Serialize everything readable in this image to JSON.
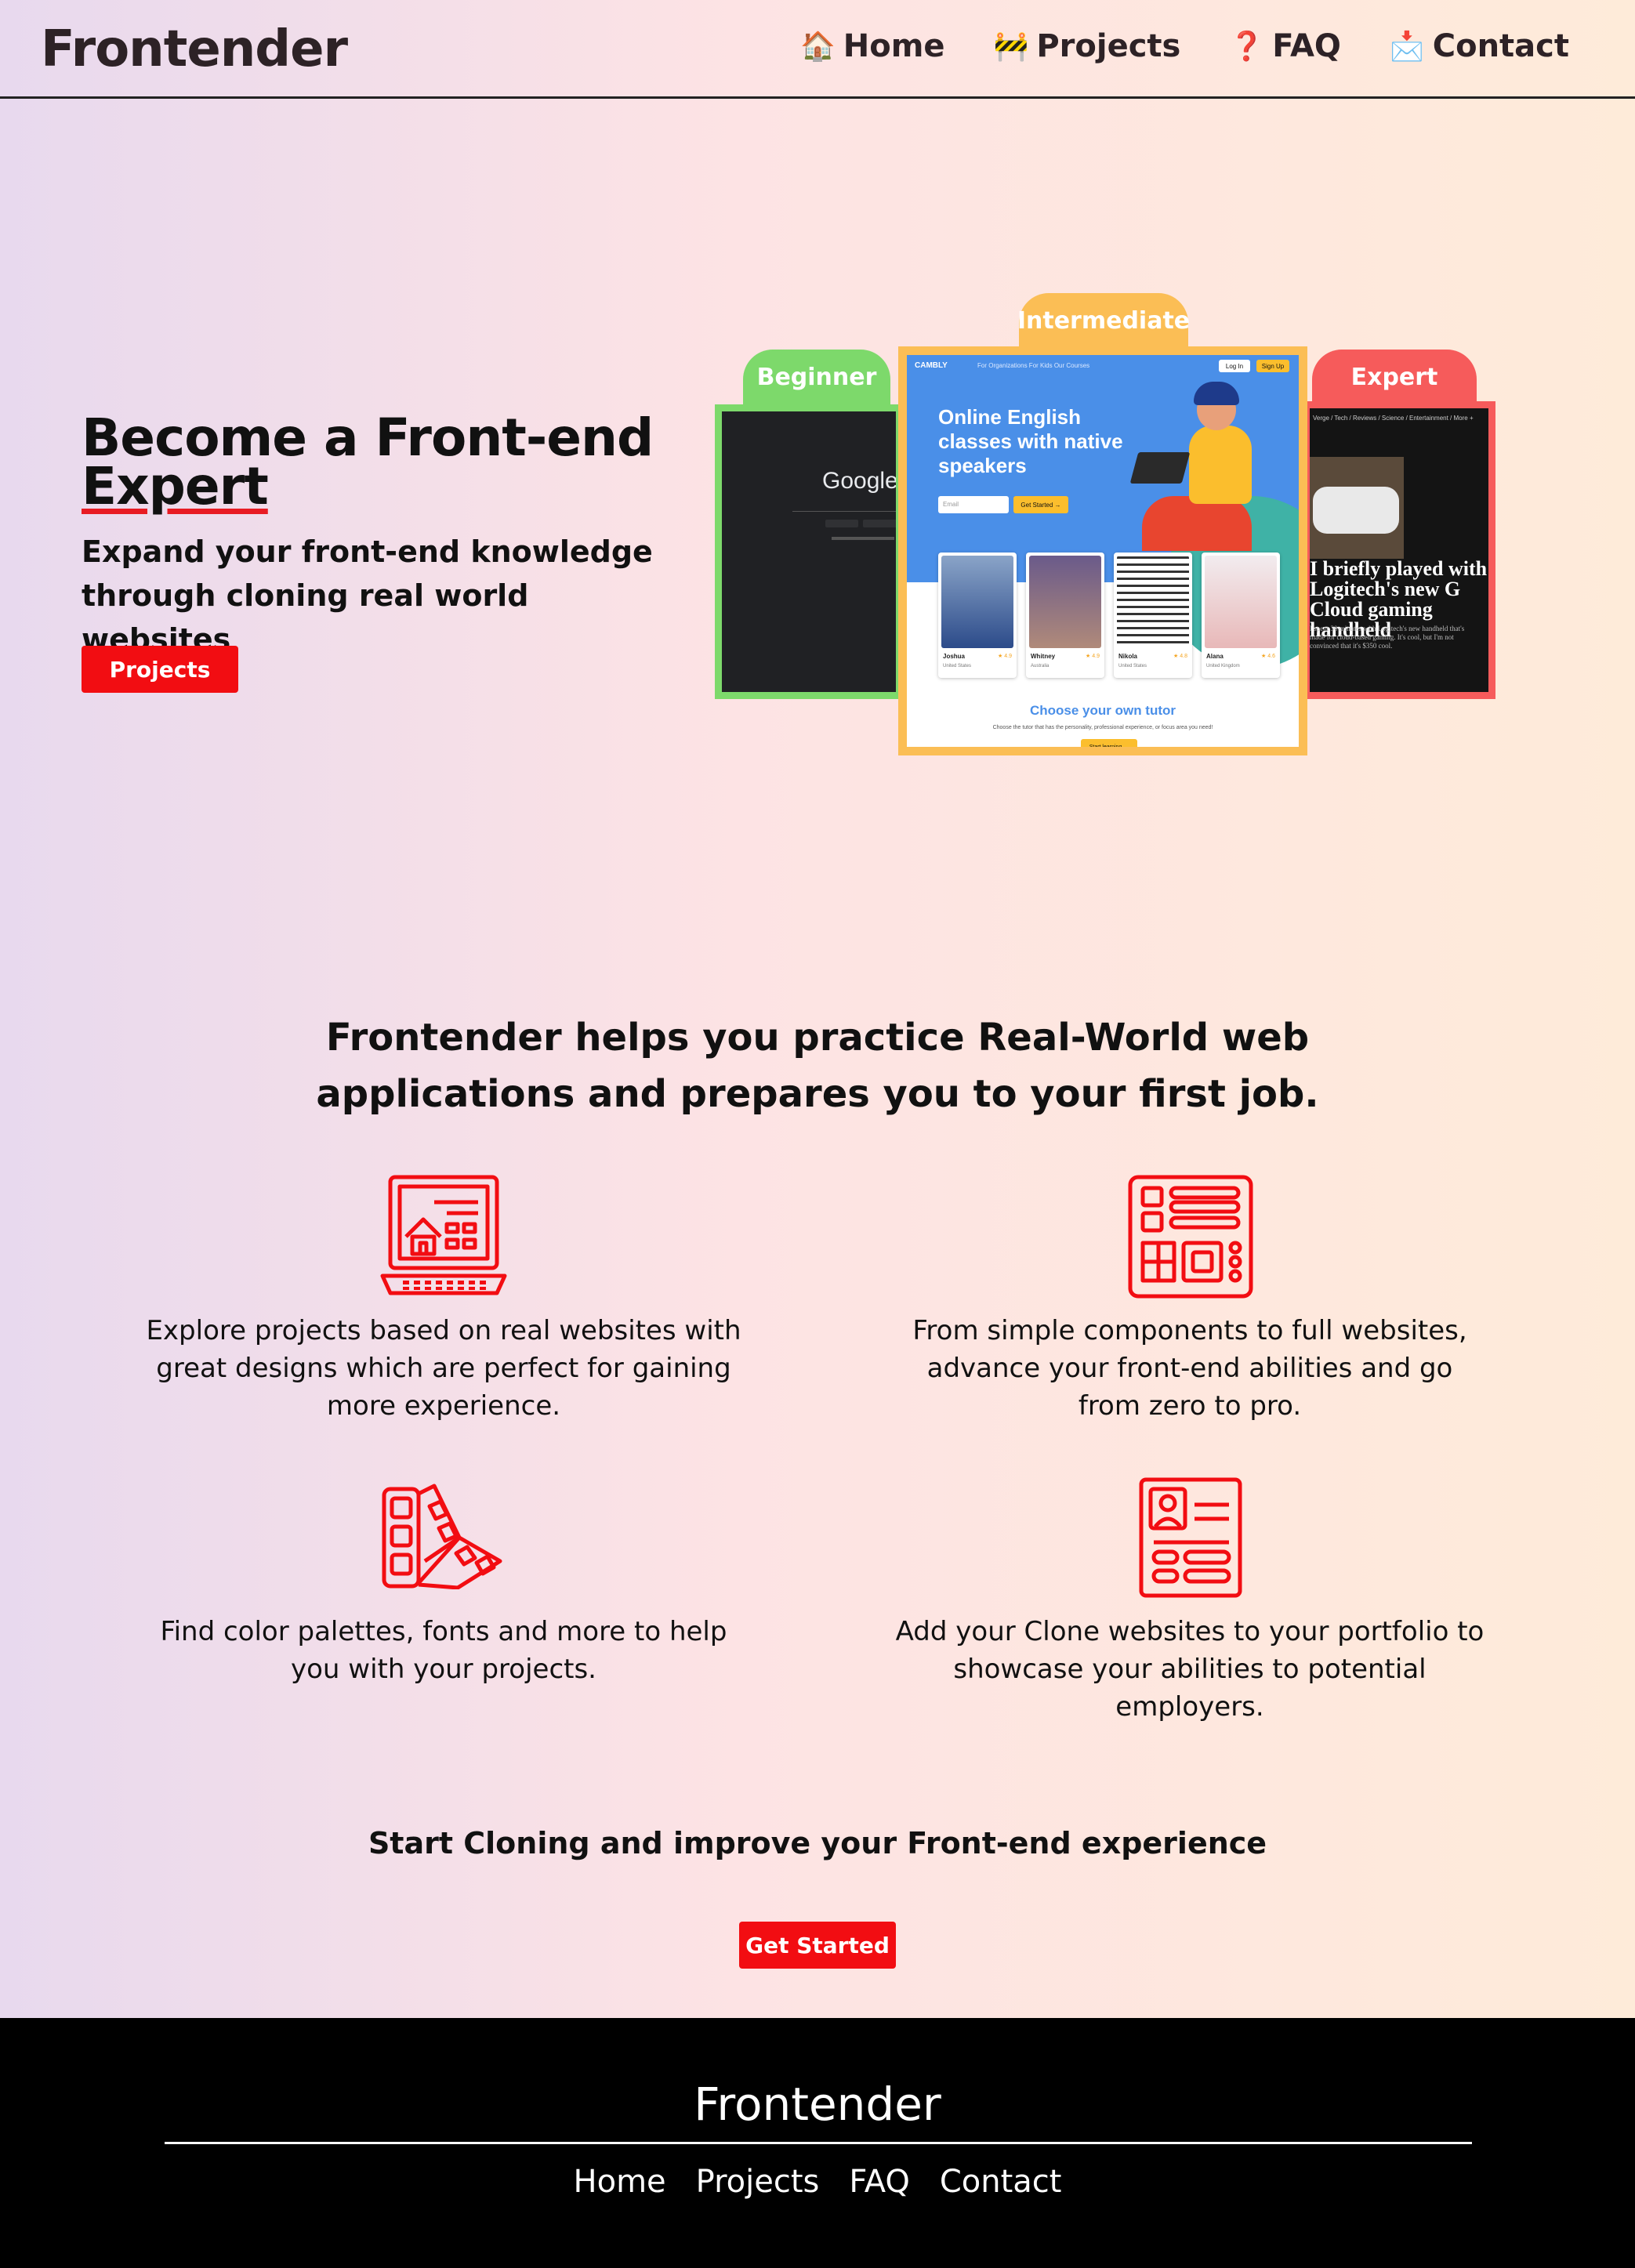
{
  "brand": "Frontender",
  "nav": {
    "items": [
      {
        "icon": "🏠",
        "label": "Home"
      },
      {
        "icon": "🚧",
        "label": "Projects"
      },
      {
        "icon": "❓",
        "label": "FAQ"
      },
      {
        "icon": "📩",
        "label": "Contact"
      }
    ]
  },
  "hero": {
    "title_line1": "Become a Front-end",
    "title_line2": "Expert",
    "subtitle": "Expand your front-end knowledge through cloning real world websites",
    "button": "Projects",
    "levels": {
      "beginner": "Beginner",
      "intermediate": "Intermediate",
      "expert": "Expert"
    },
    "beginner_preview": {
      "logo_text": "Google"
    },
    "intermediate_preview": {
      "brand": "CAMBLY",
      "menu": "For Organizations   For Kids   Our Courses",
      "login": "Log In",
      "signup": "Sign Up",
      "headline": "Online English classes with native speakers",
      "email_placeholder": "Email",
      "get_started": "Get Started →",
      "tutors": [
        {
          "name": "Joshua",
          "rating": "★ 4.9",
          "country": "United States"
        },
        {
          "name": "Whitney",
          "rating": "★ 4.9",
          "country": "Australia"
        },
        {
          "name": "Nikola",
          "rating": "★ 4.8",
          "country": "United States"
        },
        {
          "name": "Alana",
          "rating": "★ 4.6",
          "country": "United Kingdom"
        }
      ],
      "choose": "Choose your own tutor",
      "choose_sub": "Choose the tutor that has the personality, professional experience, or focus area you need!",
      "start_learning": "Start learning →"
    },
    "expert_preview": {
      "nav": "Verge / Tech / Reviews / Science / Entertainment / More +",
      "headline": "I briefly played with Logitech's new G Cloud gaming handheld",
      "body": "I spent 30 minutes with Logitech's new handheld that's made for cloud-based gaming. It's cool, but I'm not convinced that it's $350 cool."
    }
  },
  "features": {
    "title": "Frontender helps you practice Real-World web applications and prepares you to your first job.",
    "items": [
      {
        "icon": "laptop-website-icon",
        "text": "Explore projects based on real websites with great designs which are perfect for gaining more experience."
      },
      {
        "icon": "layout-components-icon",
        "text": "From simple components to full websites, advance your front-end abilities and go from zero to pro."
      },
      {
        "icon": "color-palette-icon",
        "text": "Find color palettes, fonts and more to help you with your projects."
      },
      {
        "icon": "portfolio-profile-icon",
        "text": "Add your Clone websites to your portfolio to showcase your abilities to potential employers."
      }
    ]
  },
  "cta": {
    "title": "Start Cloning and improve your Front-end experience",
    "button": "Get Started"
  },
  "footer": {
    "brand": "Frontender",
    "links": [
      "Home",
      "Projects",
      "FAQ",
      "Contact"
    ]
  },
  "colors": {
    "accent": "#f20d12",
    "beginner": "#7dd96b",
    "intermediate": "#fbbe55",
    "expert": "#f65b5b"
  }
}
